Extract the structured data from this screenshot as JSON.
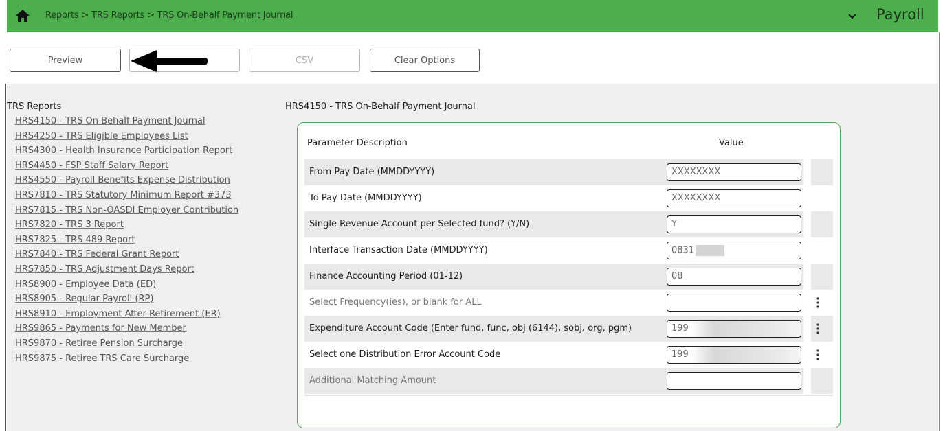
{
  "header": {
    "breadcrumb": "Reports > TRS Reports > TRS On-Behalf Payment Journal",
    "module": "Payroll",
    "accent_color": "#4cae4c"
  },
  "toolbar": {
    "preview_label": "Preview",
    "csv_label": "CSV",
    "clear_label": "Clear Options"
  },
  "nav": {
    "title": "TRS Reports",
    "items": [
      "HRS4150 - TRS On-Behalf Payment Journal",
      "HRS4250 - TRS Eligible Employees List",
      "HRS4300 - Health Insurance Participation Report",
      "HRS4450 - FSP Staff Salary Report",
      "HRS4550 - Payroll Benefits Expense Distribution",
      "HRS7810 - TRS Statutory Minimum Report #373",
      "HRS7815 - TRS Non-OASDI Employer Contribution",
      "HRS7820 - TRS 3 Report",
      "HRS7825 - TRS 489 Report",
      "HRS7840 - TRS Federal Grant Report",
      "HRS7850 - TRS Adjustment Days Report",
      "HRS8900 - Employee Data (ED)",
      "HRS8905 - Regular Payroll (RP)",
      "HRS8910 - Employment After Retirement (ER)",
      "HRS9865 - Payments for New Member",
      "HRS9870 - Retiree Pension Surcharge",
      "HRS9875 - Retiree TRS Care Surcharge"
    ]
  },
  "report": {
    "title": "HRS4150 - TRS On-Behalf Payment Journal",
    "col_desc": "Parameter Description",
    "col_value": "Value",
    "params": [
      {
        "label": "From Pay Date (MMDDYYYY)",
        "value": "XXXXXXXX"
      },
      {
        "label": "To Pay Date (MMDDYYYY)",
        "value": "XXXXXXXX"
      },
      {
        "label": "Single Revenue Account per Selected fund? (Y/N)",
        "value": "Y"
      },
      {
        "label": "Interface Transaction Date (MMDDYYYY)",
        "value": "0831"
      },
      {
        "label": "Finance Accounting Period (01-12)",
        "value": "08"
      },
      {
        "label": "Select Frequency(ies), or blank for ALL",
        "value": ""
      },
      {
        "label": "Expenditure Account Code (Enter fund, func, obj (6144), sobj, org, pgm)",
        "value": "199"
      },
      {
        "label": "Select one Distribution Error Account Code",
        "value": "199"
      },
      {
        "label": "Additional Matching Amount",
        "value": ""
      }
    ]
  }
}
